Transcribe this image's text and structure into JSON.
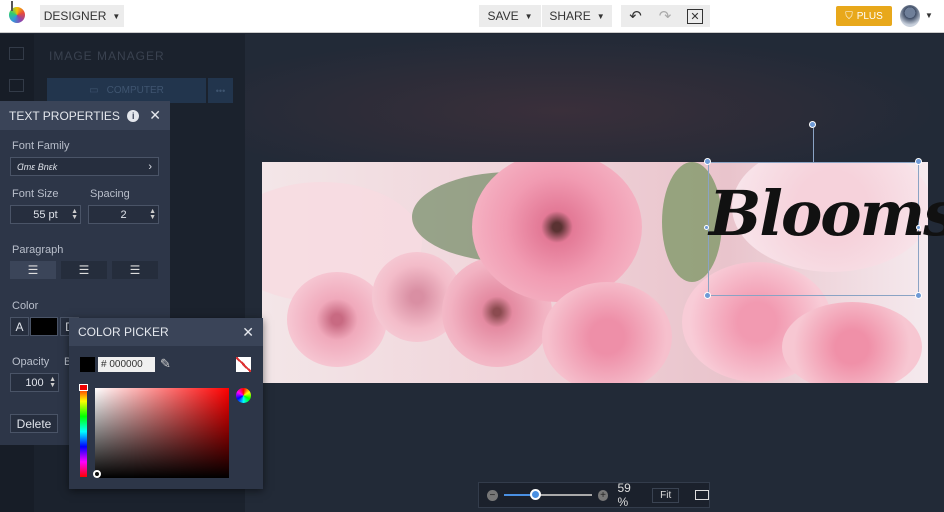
{
  "topbar": {
    "mode": "DESIGNER",
    "save": "SAVE",
    "share": "SHARE",
    "plus": "PLUS"
  },
  "image_manager": {
    "title": "IMAGE MANAGER",
    "computer": "COMPUTER",
    "more": "•••"
  },
  "text_properties": {
    "title": "TEXT PROPERTIES",
    "font_family_label": "Font Family",
    "font_family_value": "Ɑmɛ Bnɛk",
    "font_size_label": "Font Size",
    "font_size": "55 pt",
    "spacing_label": "Spacing",
    "spacing": "2",
    "paragraph_label": "Paragraph",
    "color_label": "Color",
    "color_a": "A",
    "color_d": "D",
    "text_color": "#000000",
    "opacity_label": "Opacity",
    "opacity": "100",
    "blend_label": "B",
    "delete": "Delete"
  },
  "color_picker": {
    "title": "COLOR PICKER",
    "hex": "# 000000",
    "hue_color": "#ff0000"
  },
  "canvas": {
    "text": "Blooms"
  },
  "zoom": {
    "minus": "−",
    "plus": "+",
    "value": "59 %",
    "fit": "Fit",
    "percent": 59
  },
  "colors": {
    "accent": "#e8a81b",
    "panel": "#2d3648",
    "selection": "#6e9ad6"
  }
}
